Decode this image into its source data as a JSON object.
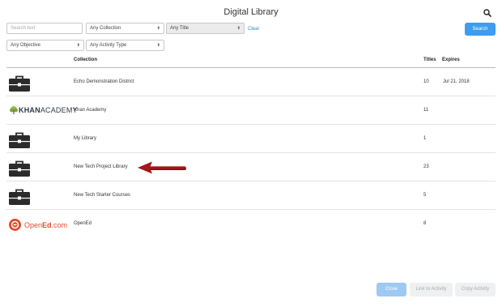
{
  "header": {
    "title": "Digital Library",
    "search_icon": "magnifier-icon"
  },
  "filters": {
    "search_placeholder": "Search text",
    "collection_select": "Any Collection",
    "title_select": "Any Title",
    "clear_label": "Clear",
    "objective_select": "Any Objective",
    "activity_type_select": "Any Activity Type",
    "search_button": "Search"
  },
  "table": {
    "columns": {
      "collection": "Collection",
      "titles": "Titles",
      "expires": "Expires"
    },
    "rows": [
      {
        "logo": "briefcase-icon",
        "name": "Echo Demonstration District",
        "titles": "10",
        "expires": "Jul 21, 2018"
      },
      {
        "logo": "khan-academy-logo",
        "logo_text_bold": "KHAN",
        "logo_text": "ACADEMY",
        "name": "Khan Academy",
        "titles": "11",
        "expires": ""
      },
      {
        "logo": "briefcase-icon",
        "name": "My Library",
        "titles": "1",
        "expires": ""
      },
      {
        "logo": "briefcase-icon",
        "name": "New Tech Project Library",
        "titles": "23",
        "expires": ""
      },
      {
        "logo": "briefcase-icon",
        "name": "New Tech Starter Courses",
        "titles": "5",
        "expires": ""
      },
      {
        "logo": "opened-logo",
        "logo_text_a": "Open",
        "logo_text_b": "Ed",
        "logo_text_c": ".com",
        "name": "OpenEd",
        "titles": "8",
        "expires": ""
      }
    ]
  },
  "footer": {
    "close_label": "Close",
    "link_label": "Link to Activity",
    "copy_label": "Copy Activity"
  },
  "colors": {
    "accent": "#3d9df0",
    "arrow": "#a4161a",
    "opened": "#e24a2b",
    "briefcase": "#2b2b2b"
  }
}
